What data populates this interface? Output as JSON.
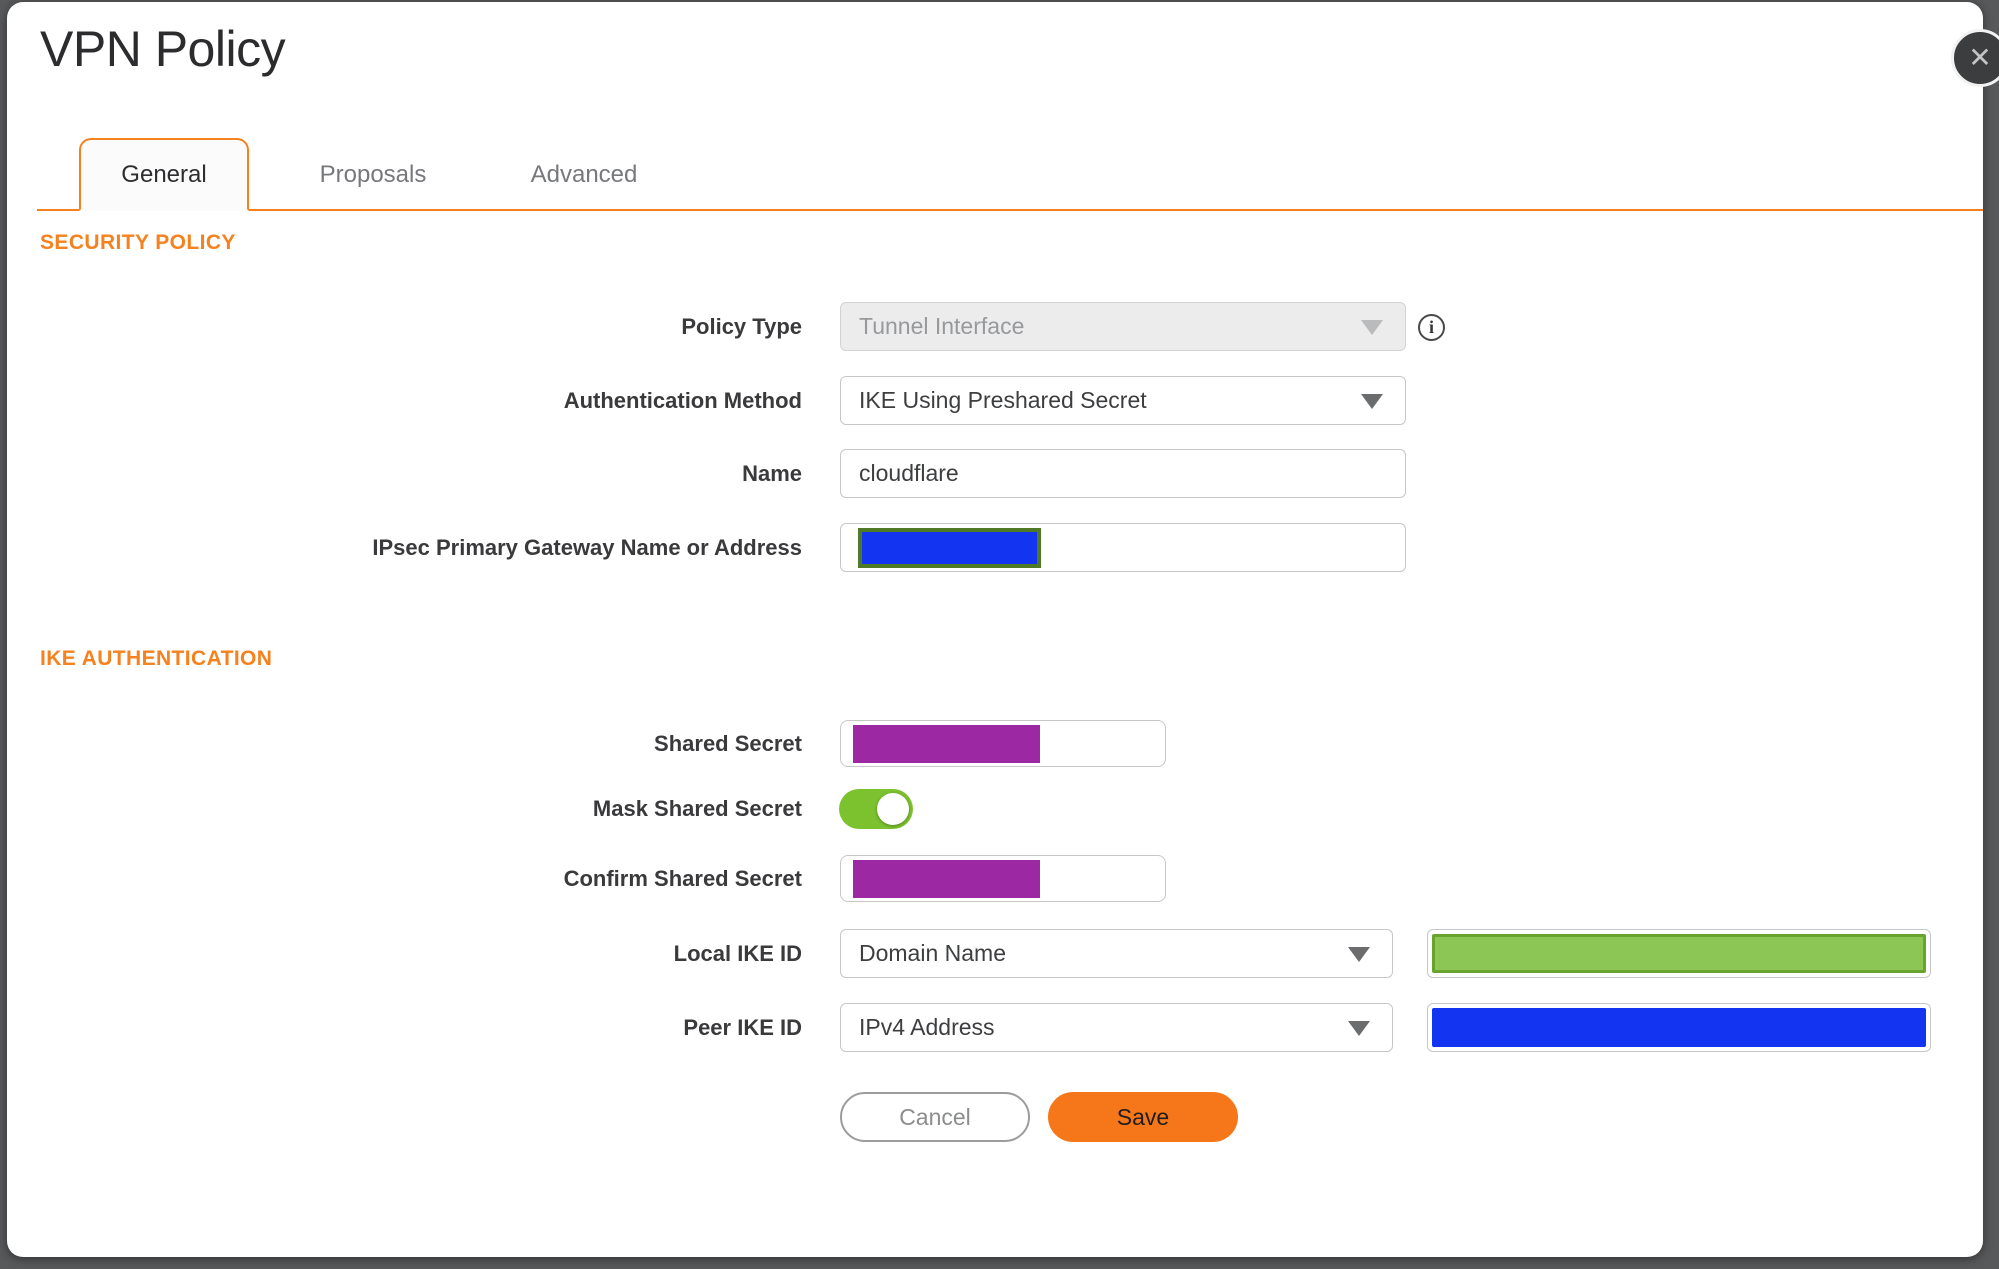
{
  "modal": {
    "title": "VPN Policy"
  },
  "icons": {
    "close": "✕",
    "info": "i"
  },
  "tabs": [
    {
      "label": "General",
      "active": true
    },
    {
      "label": "Proposals",
      "active": false
    },
    {
      "label": "Advanced",
      "active": false
    }
  ],
  "sections": {
    "security_policy": "SECURITY POLICY",
    "ike_authentication": "IKE AUTHENTICATION"
  },
  "fields": {
    "policy_type": {
      "label": "Policy Type",
      "value": "Tunnel Interface",
      "disabled": true
    },
    "auth_method": {
      "label": "Authentication Method",
      "value": "IKE Using Preshared Secret"
    },
    "name": {
      "label": "Name",
      "value": "cloudflare"
    },
    "gateway": {
      "label": "IPsec Primary Gateway Name or Address",
      "value_state": "redacted"
    },
    "shared_secret": {
      "label": "Shared Secret",
      "value_state": "redacted"
    },
    "mask_shared_secret": {
      "label": "Mask Shared Secret",
      "state": "on"
    },
    "confirm_shared_secret": {
      "label": "Confirm Shared Secret",
      "value_state": "redacted"
    },
    "local_ike_id": {
      "label": "Local IKE ID",
      "value": "Domain Name",
      "value_state": "redacted"
    },
    "peer_ike_id": {
      "label": "Peer IKE ID",
      "value": "IPv4 Address",
      "value_state": "redacted"
    }
  },
  "buttons": {
    "cancel": "Cancel",
    "save": "Save"
  },
  "colors": {
    "accent": "#F5821F",
    "save": "#F6771A",
    "purple": "#9C28A3",
    "blue": "#1334F0",
    "olive": "#4E7A25",
    "greenfill": "#8CC655",
    "greenborder": "#69A32F",
    "toggle": "#7CC22F",
    "backdrop": "#58595B"
  }
}
